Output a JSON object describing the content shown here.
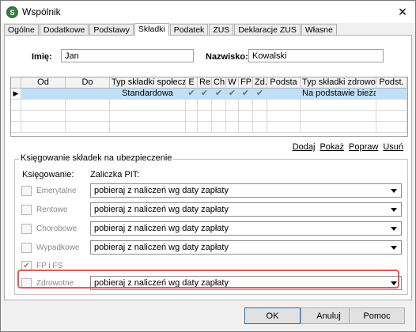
{
  "window": {
    "title": "Wspólnik",
    "close_symbol": "✕",
    "icon_letter": "S"
  },
  "tabs": [
    {
      "label": "Ogólne"
    },
    {
      "label": "Dodatkowe"
    },
    {
      "label": "Podstawy"
    },
    {
      "label": "Składki"
    },
    {
      "label": "Podatek"
    },
    {
      "label": "ZUS"
    },
    {
      "label": "Deklaracje ZUS"
    },
    {
      "label": "Własne"
    }
  ],
  "active_tab": "Składki",
  "form": {
    "first_name_label": "Imię:",
    "first_name_value": "Jan",
    "last_name_label": "Nazwisko:",
    "last_name_value": "Kowalski"
  },
  "grid": {
    "headers": [
      "Od",
      "Do",
      "Typ składki społecz",
      "E",
      "Re",
      "Ch",
      "W",
      "FP",
      "Zd.",
      "Podsta",
      "Typ składki zdrowotne",
      "Podst."
    ],
    "row": {
      "indicator": "▶",
      "od": "",
      "do": "",
      "typ_spoleczne": "Standardowa",
      "checks": [
        "✔",
        "✔",
        "✔",
        "✔",
        "✔",
        "✔"
      ],
      "podstawa": "",
      "typ_zdrowotne": "Na podstawie bieżą",
      "podst": ""
    }
  },
  "actions": [
    "Dodaj",
    "Pokaż",
    "Popraw",
    "Usuń"
  ],
  "booking": {
    "group_title": "Księgowanie składek na ubezpieczenie",
    "col_booking": "Księgowanie:",
    "col_pit": "Zaliczka PIT:",
    "rows": [
      {
        "label": "Emerytalne",
        "checked": false,
        "pit": "pobieraj z naliczeń wg daty zapłaty"
      },
      {
        "label": "Rentowe",
        "checked": false,
        "pit": "pobieraj z naliczeń wg daty zapłaty"
      },
      {
        "label": "Chorobowe",
        "checked": false,
        "pit": "pobieraj z naliczeń wg daty zapłaty"
      },
      {
        "label": "Wypadkowe",
        "checked": false,
        "pit": "pobieraj z naliczeń wg daty zapłaty"
      },
      {
        "label": "FP i FS",
        "checked": true,
        "pit": ""
      },
      {
        "label": "Zdrowotne",
        "checked": false,
        "pit": "pobieraj z naliczeń wg daty zapłaty"
      }
    ],
    "check_symbol": "✔"
  },
  "buttons": {
    "ok": "OK",
    "cancel": "Anuluj",
    "help": "Pomoc"
  },
  "colors": {
    "selection": "#bfe0f7",
    "highlight": "#e05a5a",
    "accent": "#0078d7"
  }
}
